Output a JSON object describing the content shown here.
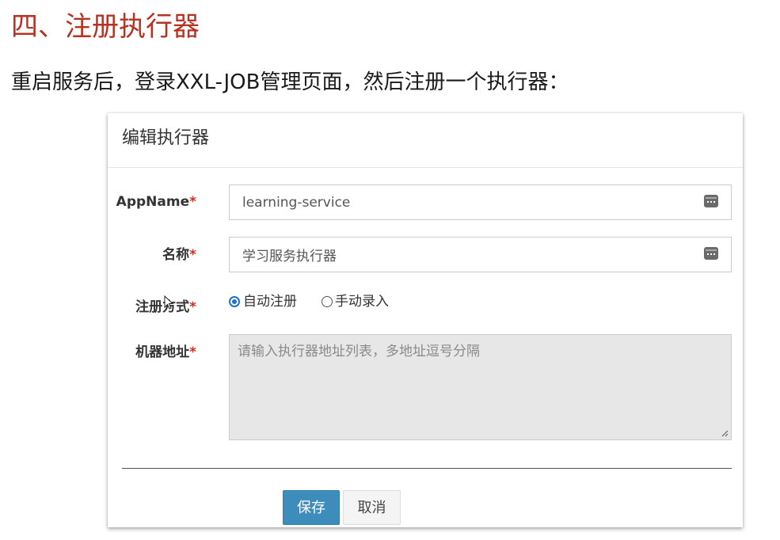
{
  "section_title": "四、注册执行器",
  "intro_text": "重启服务后，登录XXL-JOB管理页面，然后注册一个执行器：",
  "modal": {
    "title": "编辑执行器",
    "fields": {
      "appname": {
        "label": "AppName",
        "required_mark": "*",
        "value": "learning-service",
        "icon": "keyboard-icon"
      },
      "name": {
        "label": "名称",
        "required_mark": "*",
        "value": "学习服务执行器",
        "icon": "keyboard-icon"
      },
      "register_type": {
        "label": "注册方式",
        "required_mark": "*",
        "options": [
          {
            "label": "自动注册",
            "checked": true
          },
          {
            "label": "手动录入",
            "checked": false
          }
        ]
      },
      "address": {
        "label": "机器地址",
        "required_mark": "*",
        "value": "",
        "placeholder": "请输入执行器地址列表，多地址逗号分隔"
      }
    },
    "buttons": {
      "save": "保存",
      "cancel": "取消"
    }
  },
  "colors": {
    "section_title": "#b83223",
    "required": "#dd2a1b",
    "primary_button": "#3c8dbc",
    "radio_accent": "#1f6fcf",
    "disabled_textarea": "#e7e7e7"
  }
}
